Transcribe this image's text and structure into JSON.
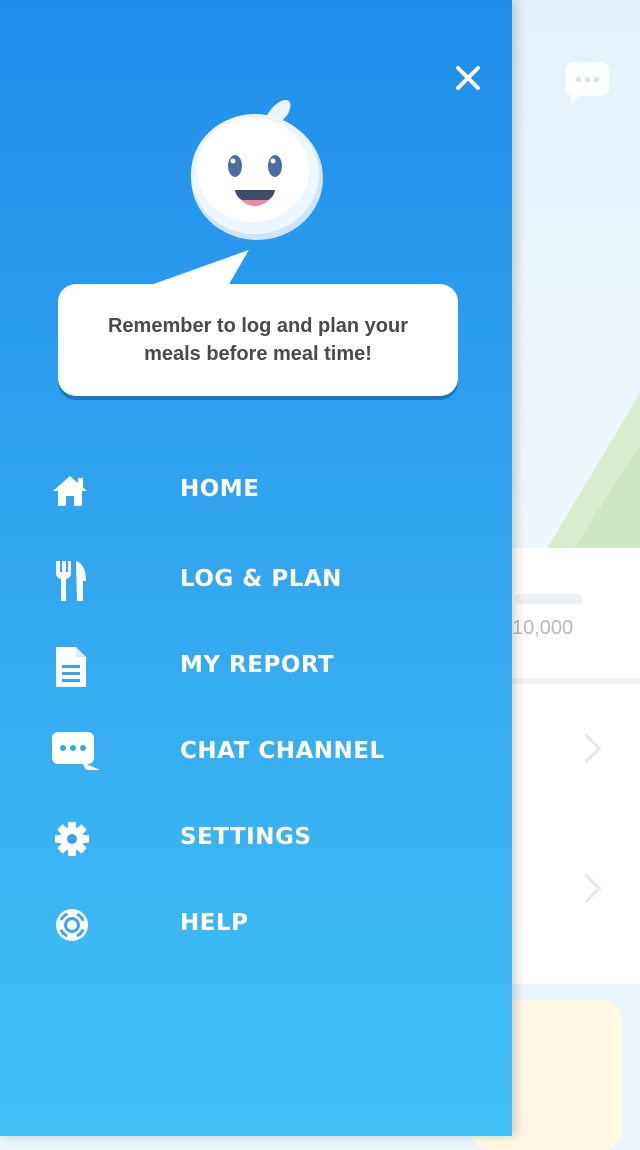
{
  "background": {
    "steps_value": "10,000"
  },
  "drawer": {
    "message": "Remember to log and plan your meals before meal time!",
    "menu": [
      {
        "label": "HOME",
        "icon": "home-icon"
      },
      {
        "label": "LOG & PLAN",
        "icon": "fork-knife-icon"
      },
      {
        "label": "MY REPORT",
        "icon": "document-icon"
      },
      {
        "label": "CHAT CHANNEL",
        "icon": "chat-icon"
      },
      {
        "label": "SETTINGS",
        "icon": "gear-icon"
      },
      {
        "label": "HELP",
        "icon": "lifebuoy-icon"
      }
    ]
  },
  "colors": {
    "drawer_top": "#1f8eea",
    "drawer_bottom": "#41c1f6",
    "text_on_drawer": "#ffffff"
  }
}
